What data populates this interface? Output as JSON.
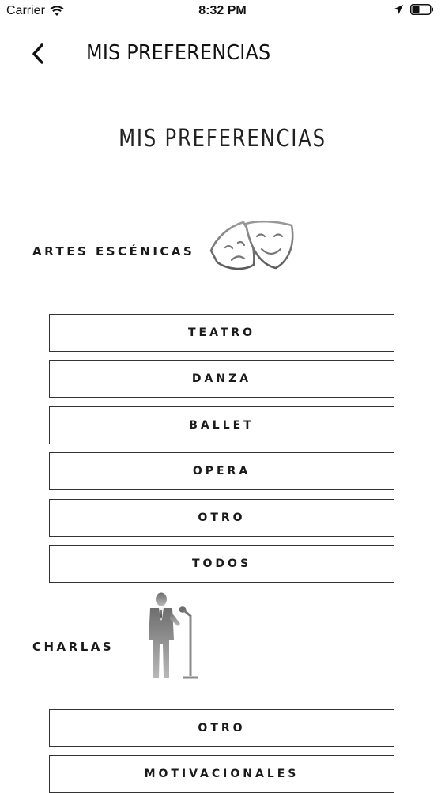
{
  "status_bar": {
    "carrier": "Carrier",
    "time": "8:32 PM",
    "icons": [
      "wifi-icon",
      "location-arrow-icon",
      "battery-icon"
    ]
  },
  "nav": {
    "back_icon": "chevron-left-icon",
    "title": "MIS PREFERENCIAS"
  },
  "heading": "MIS PREFERENCIAS",
  "sections": [
    {
      "label": "ARTES ESCÉNICAS",
      "icon": "theater-masks-icon",
      "options": [
        "TEATRO",
        "DANZA",
        "BALLET",
        "OPERA",
        "OTRO",
        "TODOS"
      ]
    },
    {
      "label": "CHARLAS",
      "icon": "speaker-at-microphone-icon",
      "options": [
        "OTRO",
        "MOTIVACIONALES"
      ]
    }
  ]
}
